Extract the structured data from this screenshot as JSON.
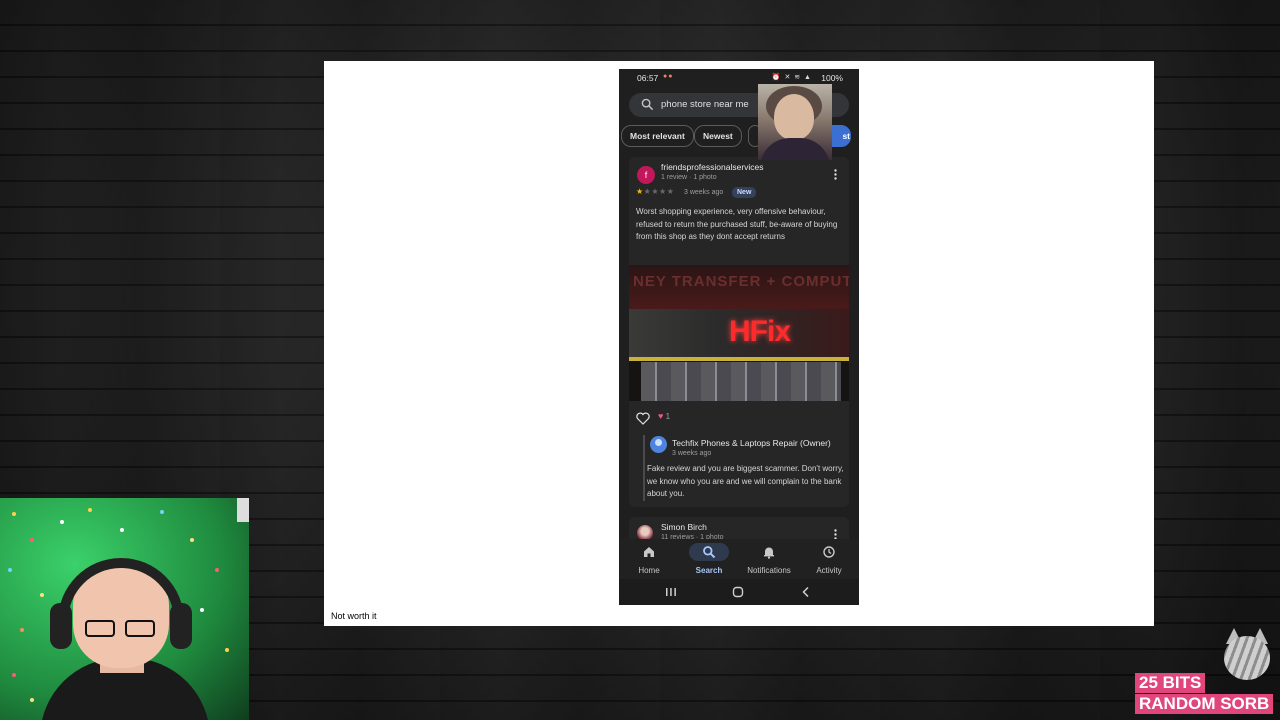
{
  "slide": {
    "caption": "Not worth it"
  },
  "phone": {
    "status": {
      "time": "06:57",
      "battery": "100%"
    },
    "search": {
      "query": "phone store near me"
    },
    "filters": [
      {
        "label": "Most relevant"
      },
      {
        "label": "Newest"
      },
      {
        "label": ""
      },
      {
        "label": "st"
      }
    ],
    "review": {
      "avatar_letter": "f",
      "name": "friendsprofessionalservices",
      "meta": "1 review · 1 photo",
      "rating": 1,
      "max_rating": 5,
      "date": "3 weeks ago",
      "badge": "New",
      "text": "Worst shopping experience, very offensive behaviour, refused to return the purchased stuff, be-aware of buying from this shop as they dont accept returns",
      "photo": {
        "banner_text": "NEY TRANSFER + COMPUTER",
        "logo_text": "HFix"
      },
      "likes": "1",
      "owner_reply": {
        "name": "Techfix Phones & Laptops Repair (Owner)",
        "date": "3 weeks ago",
        "text": "Fake review and you are biggest scammer. Don't worry, we know who you are and we will complain to the bank about you."
      }
    },
    "next_review": {
      "name": "Simon Birch",
      "meta": "11 reviews · 1 photo"
    },
    "nav": [
      {
        "label": "Home",
        "icon": "home-icon"
      },
      {
        "label": "Search",
        "icon": "search-icon",
        "active": true
      },
      {
        "label": "Notifications",
        "icon": "bell-icon"
      },
      {
        "label": "Activity",
        "icon": "activity-icon"
      }
    ]
  },
  "branding": {
    "line1": "25 BITS",
    "line2": "RANDOM SORB"
  },
  "colors": {
    "accent": "#3b6fd1",
    "brand": "#e0467c",
    "star": "#fbbc04"
  }
}
